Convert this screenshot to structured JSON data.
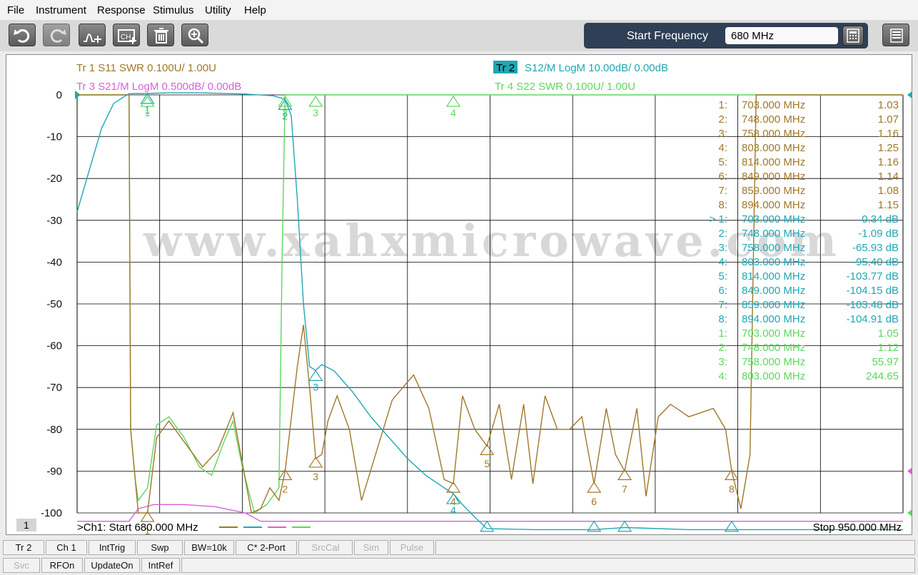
{
  "menu": [
    "File",
    "Instrument",
    "Response",
    "Stimulus",
    "Utility",
    "Help"
  ],
  "toolbar": {
    "icons": [
      "undo-icon",
      "redo-icon",
      "marker-add-icon",
      "channel-add-icon",
      "trash-icon",
      "zoom-in-icon"
    ],
    "start_frequency_label": "Start Frequency",
    "start_frequency_value": "680 MHz",
    "right_icons": [
      "calculator-icon",
      "menu-grid-icon"
    ]
  },
  "colors": {
    "tr1": "#a07828",
    "tr2": "#1fa7b3",
    "tr3": "#d95fd8",
    "tr4": "#5ed65e",
    "grid": "#000000",
    "watermark": "#d8d8d8"
  },
  "traces": {
    "tr1": "Tr  1   S11 SWR 0.100U/  1.00U",
    "tr2_badge": "Tr  2",
    "tr2": "S12/M LogM 10.00dB/  0.00dB",
    "tr3": "Tr  3   S21/M LogM 0.500dB/  0.00dB",
    "tr4": "Tr  4   S22 SWR 0.100U/  1.00U"
  },
  "y_axis_labels": [
    "0",
    "-10",
    "-20",
    "-30",
    "-40",
    "-50",
    "-60",
    "-70",
    "-80",
    "-90",
    "-100"
  ],
  "watermark": "www.xahxmicrowave.com",
  "marker_table": [
    {
      "idx": "1:",
      "freq": "703.000  MHz",
      "val": "1.03",
      "trace": "tr1"
    },
    {
      "idx": "2:",
      "freq": "748.000  MHz",
      "val": "1.07",
      "trace": "tr1"
    },
    {
      "idx": "3:",
      "freq": "758.000  MHz",
      "val": "1.16",
      "trace": "tr1"
    },
    {
      "idx": "4:",
      "freq": "803.000  MHz",
      "val": "1.25",
      "trace": "tr1"
    },
    {
      "idx": "5:",
      "freq": "814.000  MHz",
      "val": "1.16",
      "trace": "tr1"
    },
    {
      "idx": "6:",
      "freq": "849.000  MHz",
      "val": "1.14",
      "trace": "tr1"
    },
    {
      "idx": "7:",
      "freq": "859.000  MHz",
      "val": "1.08",
      "trace": "tr1"
    },
    {
      "idx": "8:",
      "freq": "894.000  MHz",
      "val": "1.15",
      "trace": "tr1"
    },
    {
      "idx": "> 1:",
      "freq": "703.000  MHz",
      "val": "0.34 dB",
      "trace": "tr2"
    },
    {
      "idx": "2:",
      "freq": "748.000  MHz",
      "val": "-1.09 dB",
      "trace": "tr2"
    },
    {
      "idx": "3:",
      "freq": "758.000  MHz",
      "val": "-65.93 dB",
      "trace": "tr2"
    },
    {
      "idx": "4:",
      "freq": "803.000  MHz",
      "val": "-95.40 dB",
      "trace": "tr2"
    },
    {
      "idx": "5:",
      "freq": "814.000  MHz",
      "val": "-103.77 dB",
      "trace": "tr2"
    },
    {
      "idx": "6:",
      "freq": "849.000  MHz",
      "val": "-104.15 dB",
      "trace": "tr2"
    },
    {
      "idx": "7:",
      "freq": "859.000  MHz",
      "val": "-103.48 dB",
      "trace": "tr2"
    },
    {
      "idx": "8:",
      "freq": "894.000  MHz",
      "val": "-104.91 dB",
      "trace": "tr2"
    },
    {
      "idx": "1:",
      "freq": "703.000  MHz",
      "val": "1.05",
      "trace": "tr4"
    },
    {
      "idx": "2:",
      "freq": "748.000  MHz",
      "val": "1.12",
      "trace": "tr4"
    },
    {
      "idx": "3:",
      "freq": "758.000  MHz",
      "val": "55.97",
      "trace": "tr4"
    },
    {
      "idx": "4:",
      "freq": "803.000  MHz",
      "val": "244.65",
      "trace": "tr4"
    }
  ],
  "channel_number": "1",
  "footer": {
    "left": ">Ch1:  Start   680.000 MHz",
    "right": "Stop  950.000 MHz"
  },
  "softkeys_row1": [
    {
      "label": "Tr 2",
      "enabled": true
    },
    {
      "label": "Ch 1",
      "enabled": true
    },
    {
      "label": "IntTrig",
      "enabled": true
    },
    {
      "label": "Swp",
      "enabled": true
    },
    {
      "label": "BW=10k",
      "enabled": true
    },
    {
      "label": "C* 2-Port",
      "enabled": true
    },
    {
      "label": "SrcCal",
      "enabled": false
    },
    {
      "label": "Sim",
      "enabled": false
    },
    {
      "label": "Pulse",
      "enabled": false
    }
  ],
  "softkeys_row2": [
    {
      "label": "Svc",
      "enabled": false
    },
    {
      "label": "RFOn",
      "enabled": true
    },
    {
      "label": "UpdateOn",
      "enabled": true
    },
    {
      "label": "IntRef",
      "enabled": true
    }
  ],
  "chart_data": {
    "type": "line",
    "x_axis": {
      "start_mhz": 680,
      "stop_mhz": 950,
      "divisions": 10
    },
    "y_axis": {
      "min": -100,
      "max": 0,
      "step": 10,
      "unit": "dB"
    },
    "grid": true,
    "markers_mhz": [
      703,
      748,
      758,
      803,
      814,
      849,
      859,
      894
    ],
    "series": [
      {
        "name": "Tr 2 S12/M LogM",
        "trace": "tr2",
        "points": [
          [
            680,
            -28
          ],
          [
            684,
            -18
          ],
          [
            688,
            -8
          ],
          [
            692,
            -2
          ],
          [
            697,
            0.3
          ],
          [
            703,
            0.34
          ],
          [
            710,
            0.5
          ],
          [
            720,
            0.5
          ],
          [
            735,
            0.2
          ],
          [
            744,
            -0.2
          ],
          [
            747,
            -0.8
          ],
          [
            748,
            -1.09
          ],
          [
            750,
            -5
          ],
          [
            752,
            -25
          ],
          [
            754,
            -50
          ],
          [
            756,
            -65
          ],
          [
            758,
            -65.93
          ],
          [
            760,
            -64.5
          ],
          [
            764,
            -66
          ],
          [
            770,
            -71
          ],
          [
            776,
            -77
          ],
          [
            782,
            -82
          ],
          [
            788,
            -87
          ],
          [
            794,
            -91
          ],
          [
            800,
            -94
          ],
          [
            803,
            -95.4
          ],
          [
            806,
            -98
          ],
          [
            810,
            -101
          ],
          [
            814,
            -103.77
          ],
          [
            830,
            -104
          ],
          [
            849,
            -104.15
          ],
          [
            859,
            -103.48
          ],
          [
            880,
            -104.5
          ],
          [
            894,
            -104.91
          ],
          [
            920,
            -104.5
          ],
          [
            950,
            -104.8
          ]
        ]
      },
      {
        "name": "Tr 4 S22 SWR",
        "trace": "tr4",
        "points": [
          [
            680,
            0
          ],
          [
            697,
            0
          ],
          [
            697.5,
            -80
          ],
          [
            699,
            -92
          ],
          [
            700,
            -97
          ],
          [
            703,
            -94
          ],
          [
            706,
            -79
          ],
          [
            710,
            -77
          ],
          [
            715,
            -82
          ],
          [
            720,
            -89
          ],
          [
            724,
            -91
          ],
          [
            728,
            -83
          ],
          [
            731,
            -78
          ],
          [
            734,
            -89
          ],
          [
            738,
            -100
          ],
          [
            742,
            -98
          ],
          [
            746,
            -94
          ],
          [
            747,
            -40
          ],
          [
            748,
            0
          ],
          [
            749,
            0
          ],
          [
            750,
            0
          ],
          [
            950,
            0
          ]
        ]
      },
      {
        "name": "Tr 1 S11 SWR",
        "trace": "tr1",
        "points": [
          [
            680,
            0
          ],
          [
            697,
            0
          ],
          [
            697.5,
            -80
          ],
          [
            700,
            -100
          ],
          [
            703,
            -100
          ],
          [
            706,
            -82
          ],
          [
            710,
            -78
          ],
          [
            716,
            -84
          ],
          [
            721,
            -89
          ],
          [
            726,
            -85
          ],
          [
            731,
            -76
          ],
          [
            734,
            -88
          ],
          [
            737,
            -100
          ],
          [
            740,
            -99
          ],
          [
            743,
            -94
          ],
          [
            746,
            -97
          ],
          [
            748,
            -90
          ],
          [
            752,
            -65
          ],
          [
            754,
            -55
          ],
          [
            756,
            -70
          ],
          [
            758,
            -87
          ],
          [
            760,
            -86
          ],
          [
            762,
            -78
          ],
          [
            765,
            -72
          ],
          [
            769,
            -80
          ],
          [
            773,
            -97
          ],
          [
            778,
            -85
          ],
          [
            783,
            -73
          ],
          [
            790,
            -67
          ],
          [
            795,
            -75
          ],
          [
            800,
            -92
          ],
          [
            803,
            -93
          ],
          [
            806,
            -72
          ],
          [
            810,
            -80
          ],
          [
            814,
            -84
          ],
          [
            818,
            -74
          ],
          [
            822,
            -92
          ],
          [
            826,
            -74
          ],
          [
            829,
            -93
          ],
          [
            833,
            -72
          ],
          [
            837,
            -80
          ],
          [
            841,
            -80
          ],
          [
            845,
            -77
          ],
          [
            849,
            -93
          ],
          [
            853,
            -75
          ],
          [
            856,
            -86
          ],
          [
            859,
            -90
          ],
          [
            863,
            -75
          ],
          [
            866,
            -96
          ],
          [
            870,
            -77
          ],
          [
            874,
            -74
          ],
          [
            880,
            -77
          ],
          [
            888,
            -75
          ],
          [
            892,
            -80
          ],
          [
            894,
            -90
          ],
          [
            897,
            -99
          ],
          [
            900,
            -86
          ],
          [
            902,
            0
          ],
          [
            950,
            0
          ]
        ]
      },
      {
        "name": "Tr 3 S21/M LogM",
        "trace": "tr3",
        "points": [
          [
            680,
            -102
          ],
          [
            690,
            -102
          ],
          [
            697,
            -102
          ],
          [
            700,
            -99
          ],
          [
            705,
            -98
          ],
          [
            715,
            -98
          ],
          [
            725,
            -98.5
          ],
          [
            735,
            -100
          ],
          [
            740,
            -102
          ],
          [
            950,
            -102
          ]
        ]
      }
    ]
  }
}
